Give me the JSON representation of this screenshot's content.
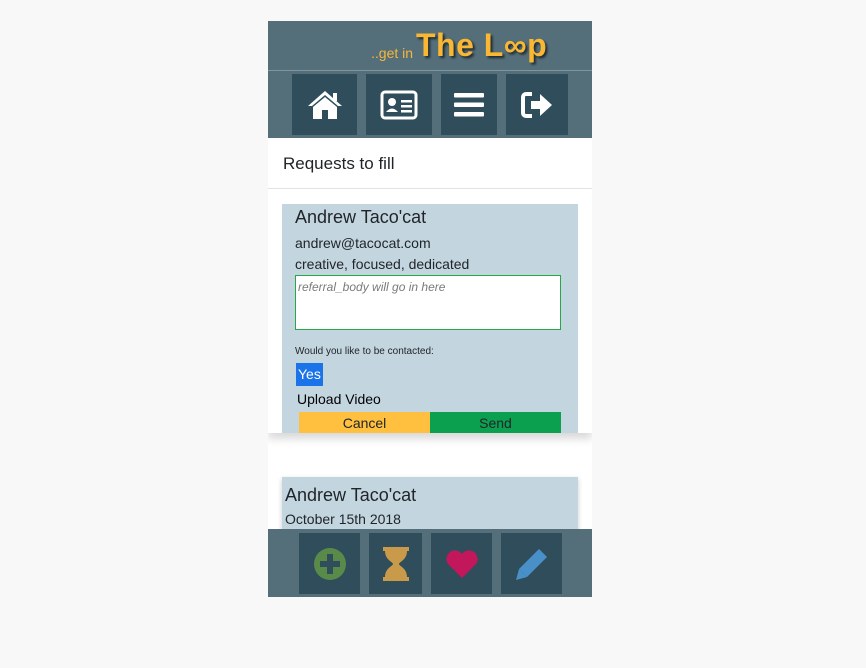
{
  "header": {
    "tagline": "..get in",
    "brand": "The L∞p",
    "nav": [
      {
        "icon": "home-icon"
      },
      {
        "icon": "id-card-icon"
      },
      {
        "icon": "menu-icon"
      },
      {
        "icon": "sign-out-icon"
      }
    ]
  },
  "section_title": "Requests to fill",
  "request_card": {
    "name": "Andrew Taco'cat",
    "email": "andrew@tacocat.com",
    "traits": "creative, focused, dedicated",
    "referral_placeholder": "referral_body will go in here",
    "contact_question": "Would you like to be contacted:",
    "contact_selected": "Yes",
    "upload_label": "Upload Video",
    "cancel_label": "Cancel",
    "send_label": "Send"
  },
  "second_card": {
    "name": "Andrew Taco'cat",
    "date": "October 15th 2018"
  },
  "footer": {
    "icons": [
      "add-circle-icon",
      "hourglass-icon",
      "heart-icon",
      "pencil-icon"
    ],
    "colors": {
      "add": "#5a8a4a",
      "hourglass": "#c99a4a",
      "heart": "#c2185b",
      "pencil": "#4a90c8"
    }
  },
  "colors": {
    "header": "#546e7a",
    "button_dark": "#2f4d5a",
    "brand": "#f9b734",
    "card": "#c3d6e0",
    "cancel": "#ffbf3f",
    "send": "#0aa04f"
  }
}
